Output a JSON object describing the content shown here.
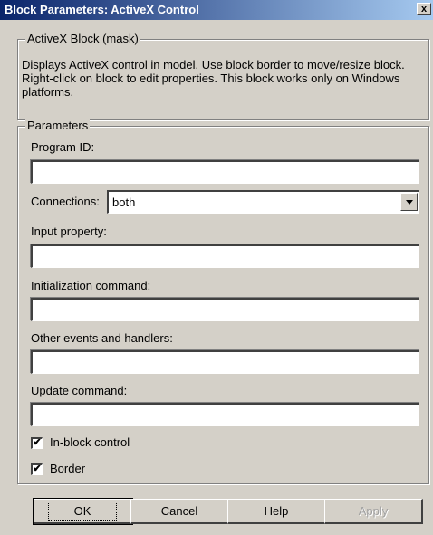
{
  "window": {
    "title": "Block Parameters: ActiveX Control",
    "close_glyph": "x"
  },
  "mask_group": {
    "legend": "ActiveX Block (mask)",
    "description": "Displays ActiveX control in model. Use block border to move/resize block. Right-click on block to edit properties. This block works only on Windows platforms."
  },
  "params_group": {
    "legend": "Parameters",
    "program_id": {
      "label": "Program ID:",
      "value": ""
    },
    "connections": {
      "label": "Connections:",
      "value": "both"
    },
    "input_property": {
      "label": "Input property:",
      "value": ""
    },
    "init_command": {
      "label": "Initialization command:",
      "value": ""
    },
    "other_events": {
      "label": "Other events and handlers:",
      "value": ""
    },
    "update_command": {
      "label": "Update command:",
      "value": ""
    },
    "in_block_control": {
      "label": "In-block control",
      "checked": true,
      "mark": "✔"
    },
    "border": {
      "label": "Border",
      "checked": true,
      "mark": "✔"
    }
  },
  "buttons": {
    "ok": "OK",
    "cancel": "Cancel",
    "help": "Help",
    "apply": "Apply"
  }
}
